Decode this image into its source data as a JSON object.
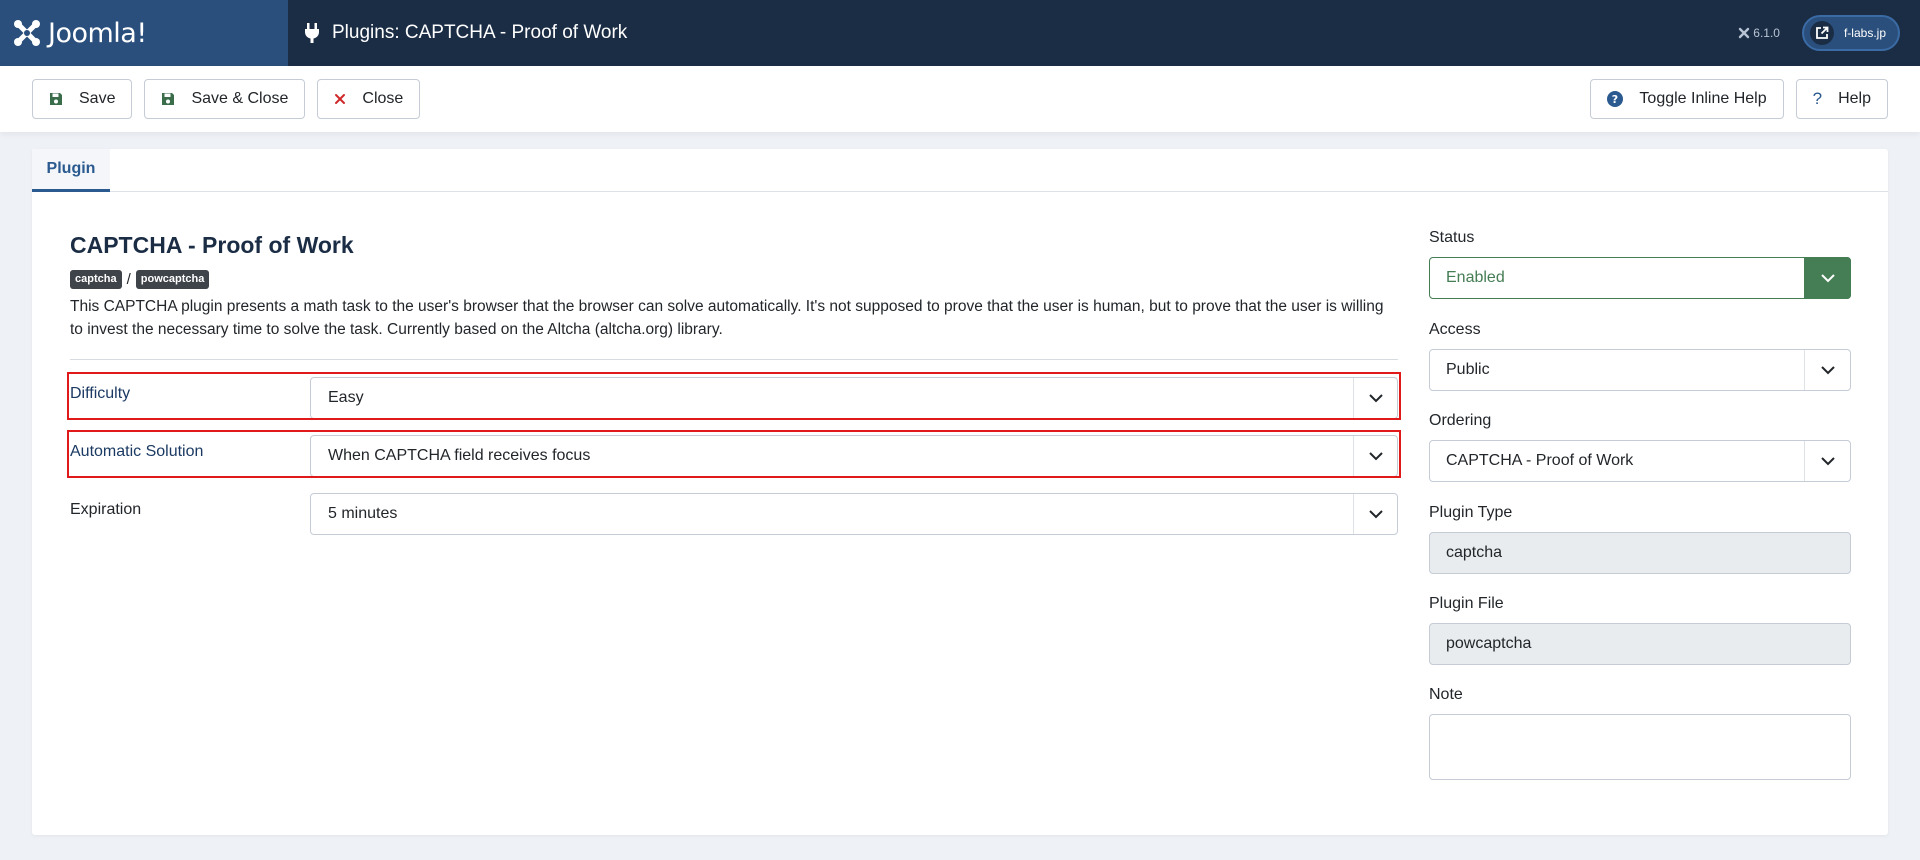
{
  "header": {
    "logo_text": "Joomla!",
    "page_title": "Plugins: CAPTCHA - Proof of Work",
    "version": "6.1.0",
    "site_label": "f-labs.jp"
  },
  "toolbar": {
    "save_label": "Save",
    "save_close_label": "Save & Close",
    "close_label": "Close",
    "toggle_help_label": "Toggle Inline Help",
    "help_label": "Help"
  },
  "tabs": [
    {
      "label": "Plugin",
      "active": true
    }
  ],
  "plugin": {
    "title": "CAPTCHA - Proof of Work",
    "badges": [
      "captcha",
      "powcaptcha"
    ],
    "badge_separator": "/",
    "description": "This CAPTCHA plugin presents a math task to the user's browser that the browser can solve automatically. It's not supposed to prove that the user is human, but to prove that the user is willing to invest the necessary time to solve the task. Currently based on the Altcha (altcha.org) library."
  },
  "fields": {
    "difficulty": {
      "label": "Difficulty",
      "value": "Easy"
    },
    "automatic_solution": {
      "label": "Automatic Solution",
      "value": "When CAPTCHA field receives focus"
    },
    "expiration": {
      "label": "Expiration",
      "value": "5 minutes"
    }
  },
  "side": {
    "status": {
      "label": "Status",
      "value": "Enabled"
    },
    "access": {
      "label": "Access",
      "value": "Public"
    },
    "ordering": {
      "label": "Ordering",
      "value": "CAPTCHA - Proof of Work"
    },
    "plugin_type": {
      "label": "Plugin Type",
      "value": "captcha"
    },
    "plugin_file": {
      "label": "Plugin File",
      "value": "powcaptcha"
    },
    "note": {
      "label": "Note",
      "value": ""
    }
  },
  "colors": {
    "header_bg": "#1b2d45",
    "logo_bg": "#2a4f7c",
    "status_green": "#457d54",
    "highlight_red": "#e01a1a",
    "close_red": "#d02828",
    "save_green": "#3a6e4b",
    "help_blue": "#2a5a8f"
  }
}
